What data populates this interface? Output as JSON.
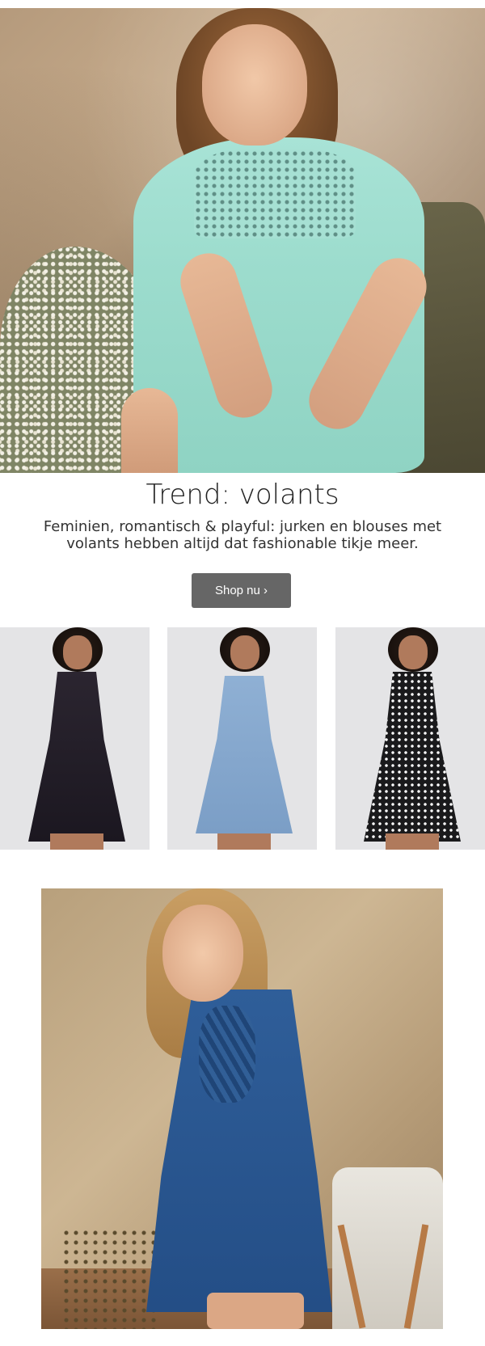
{
  "hero": {
    "image_alt": "Model in mint green dress with ruffles"
  },
  "headline": {
    "title": "Trend: volants",
    "text": "Feminien, romantisch & playful: jurken en blouses met volants hebben altijd dat fashionable tikje meer."
  },
  "cta": {
    "label": "Shop nu ›"
  },
  "products": [
    {
      "name": "black-ruffle-dress"
    },
    {
      "name": "light-blue-dress"
    },
    {
      "name": "black-dotted-dress"
    }
  ],
  "feature": {
    "image_alt": "Model in blue ruffle dress"
  },
  "colors": {
    "button_bg": "#666666",
    "page_bg": "#ffffff"
  }
}
